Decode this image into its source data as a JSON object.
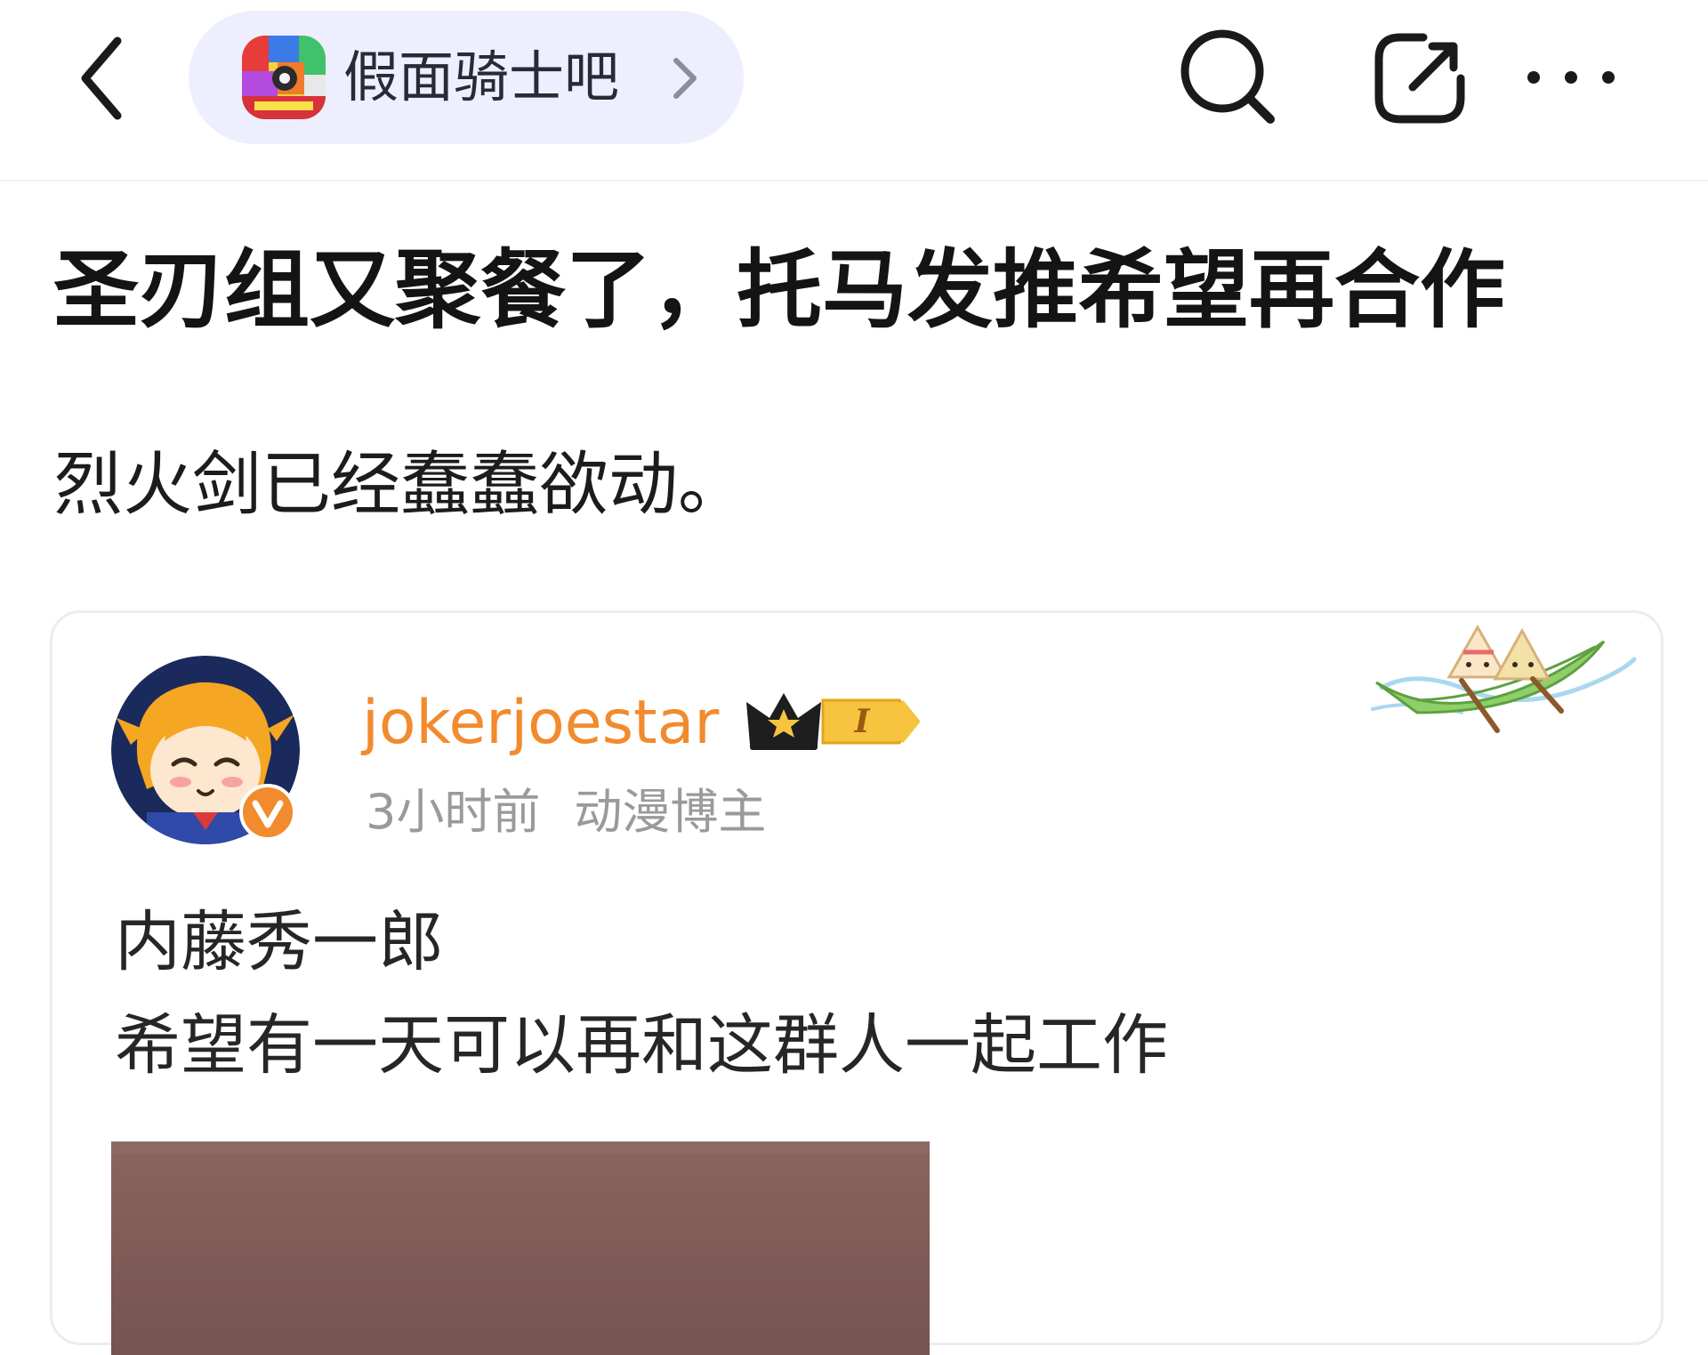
{
  "header": {
    "back_icon": "chevron-left-icon",
    "forum_name": "假面骑士吧",
    "forum_chevron_icon": "chevron-right-icon",
    "search_icon": "search-icon",
    "share_icon": "share-icon",
    "more_icon": "more-dots-icon"
  },
  "post": {
    "title": "圣刃组又聚餐了，托马发推希望再合作",
    "body": "烈火剑已经蠢蠢欲动。"
  },
  "embed": {
    "username": "jokerjoestar",
    "member_level": "I",
    "time": "3小时前",
    "role": "动漫博主",
    "lines": [
      "内藤秀一郎",
      "希望有一天可以再和这群人一起工作"
    ]
  },
  "colors": {
    "accent_username": "#f28a2e",
    "forum_pill_bg": "#eeeffe",
    "meta_gray": "#9a9a9a"
  }
}
